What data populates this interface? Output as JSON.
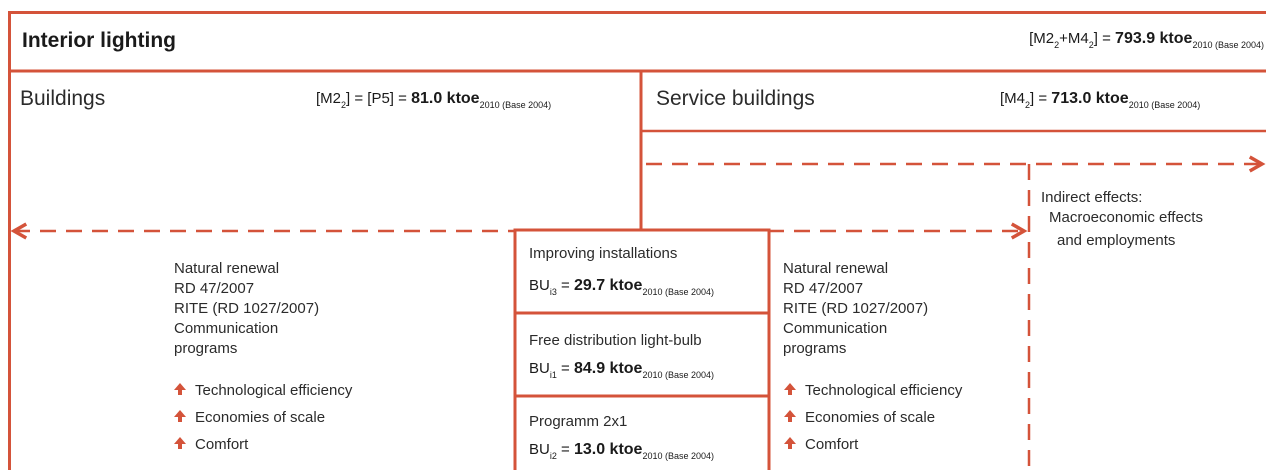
{
  "header": {
    "title": "Interior lighting",
    "formula_prefix": "[M2",
    "formula_sub1": "2",
    "formula_mid": "+M4",
    "formula_sub2": "2",
    "formula_eq": "] = ",
    "formula_value": "793.9 ktoe",
    "formula_base": "2010 (Base 2004)"
  },
  "buildings": {
    "label": "Buildings",
    "formula_prefix": "[M2",
    "formula_sub": "2",
    "formula_eq": "] = [P5] = ",
    "formula_value": "81.0 ktoe",
    "formula_base": "2010 (Base 2004)"
  },
  "service": {
    "label": "Service buildings",
    "formula_prefix": "[M4",
    "formula_sub": "2",
    "formula_eq": "] = ",
    "formula_value": "713.0 ktoe",
    "formula_base": "2010 (Base 2004)"
  },
  "indirect": {
    "line1": "Indirect effects:",
    "line2": "Macroeconomic effects",
    "line3": "and employments"
  },
  "left_list": {
    "items": [
      "Natural renewal",
      "RD 47/2007",
      "RITE (RD 1027/2007)",
      "Communication",
      "programs"
    ],
    "effects": [
      "Technological efficiency",
      "Economies of scale",
      "Comfort"
    ]
  },
  "right_list": {
    "items": [
      "Natural renewal",
      "RD 47/2007",
      "RITE (RD 1027/2007)",
      "Communication",
      "programs"
    ],
    "effects": [
      "Technological efficiency",
      "Economies of scale",
      "Comfort"
    ]
  },
  "measures": [
    {
      "title": "Improving installations",
      "bu": "BU",
      "sub": "i3",
      "eq": " = ",
      "value": "29.7 ktoe",
      "base": "2010 (Base 2004)"
    },
    {
      "title": "Free distribution light-bulb",
      "bu": "BU",
      "sub": "i1",
      "eq": " = ",
      "value": "84.9 ktoe",
      "base": "2010 (Base 2004)"
    },
    {
      "title": "Programm 2x1",
      "bu": "BU",
      "sub": "i2",
      "eq": " = ",
      "value": "13.0 ktoe",
      "base": "2010 (Base 2004)"
    }
  ],
  "colors": {
    "accent": "#d4533a",
    "text": "#2b2b2b"
  },
  "icons": {
    "effect": "arrow-up-icon"
  }
}
